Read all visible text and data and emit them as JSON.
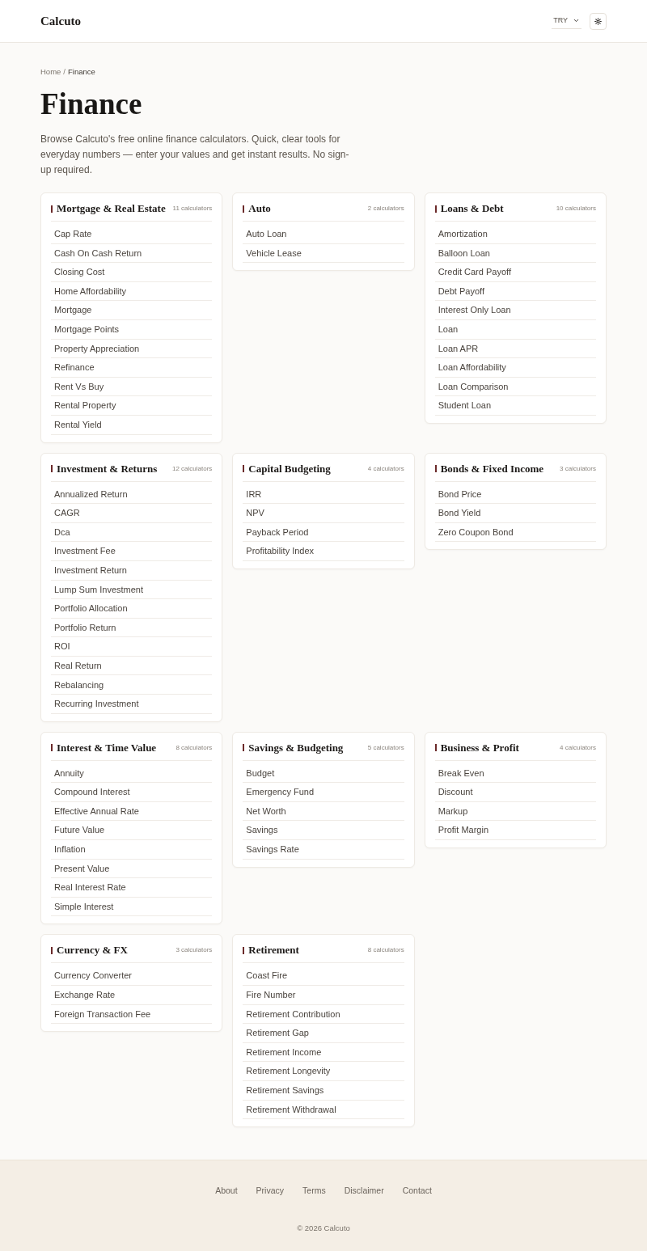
{
  "header": {
    "logo": "Calcuto",
    "currency": {
      "value": "TRY"
    }
  },
  "breadcrumb": {
    "separator": "/",
    "items": [
      {
        "label": "Home",
        "current": false
      },
      {
        "label": "Finance",
        "current": true
      }
    ]
  },
  "page": {
    "title": "Finance",
    "description": "Browse Calcuto's free online finance calculators. Quick, clear tools for everyday numbers — enter your values and get instant results. No sign-up required."
  },
  "categories": [
    {
      "title": "Mortgage & Real Estate",
      "count": "11 calculators",
      "items": [
        "Cap Rate",
        "Cash On Cash Return",
        "Closing Cost",
        "Home Affordability",
        "Mortgage",
        "Mortgage Points",
        "Property Appreciation",
        "Refinance",
        "Rent Vs Buy",
        "Rental Property",
        "Rental Yield"
      ]
    },
    {
      "title": "Auto",
      "count": "2 calculators",
      "items": [
        "Auto Loan",
        "Vehicle Lease"
      ]
    },
    {
      "title": "Loans & Debt",
      "count": "10 calculators",
      "items": [
        "Amortization",
        "Balloon Loan",
        "Credit Card Payoff",
        "Debt Payoff",
        "Interest Only Loan",
        "Loan",
        "Loan APR",
        "Loan Affordability",
        "Loan Comparison",
        "Student Loan"
      ]
    },
    {
      "title": "Investment & Returns",
      "count": "12 calculators",
      "items": [
        "Annualized Return",
        "CAGR",
        "Dca",
        "Investment Fee",
        "Investment Return",
        "Lump Sum Investment",
        "Portfolio Allocation",
        "Portfolio Return",
        "ROI",
        "Real Return",
        "Rebalancing",
        "Recurring Investment"
      ]
    },
    {
      "title": "Capital Budgeting",
      "count": "4 calculators",
      "items": [
        "IRR",
        "NPV",
        "Payback Period",
        "Profitability Index"
      ]
    },
    {
      "title": "Bonds & Fixed Income",
      "count": "3 calculators",
      "items": [
        "Bond Price",
        "Bond Yield",
        "Zero Coupon Bond"
      ]
    },
    {
      "title": "Interest & Time Value",
      "count": "8 calculators",
      "items": [
        "Annuity",
        "Compound Interest",
        "Effective Annual Rate",
        "Future Value",
        "Inflation",
        "Present Value",
        "Real Interest Rate",
        "Simple Interest"
      ]
    },
    {
      "title": "Savings & Budgeting",
      "count": "5 calculators",
      "items": [
        "Budget",
        "Emergency Fund",
        "Net Worth",
        "Savings",
        "Savings Rate"
      ]
    },
    {
      "title": "Business & Profit",
      "count": "4 calculators",
      "items": [
        "Break Even",
        "Discount",
        "Markup",
        "Profit Margin"
      ]
    },
    {
      "title": "Currency & FX",
      "count": "3 calculators",
      "items": [
        "Currency Converter",
        "Exchange Rate",
        "Foreign Transaction Fee"
      ]
    },
    {
      "title": "Retirement",
      "count": "8 calculators",
      "items": [
        "Coast Fire",
        "Fire Number",
        "Retirement Contribution",
        "Retirement Gap",
        "Retirement Income",
        "Retirement Longevity",
        "Retirement Savings",
        "Retirement Withdrawal"
      ]
    }
  ],
  "footer": {
    "links": [
      "About",
      "Privacy",
      "Terms",
      "Disclaimer",
      "Contact"
    ],
    "copyright": "© 2026 Calcuto"
  }
}
